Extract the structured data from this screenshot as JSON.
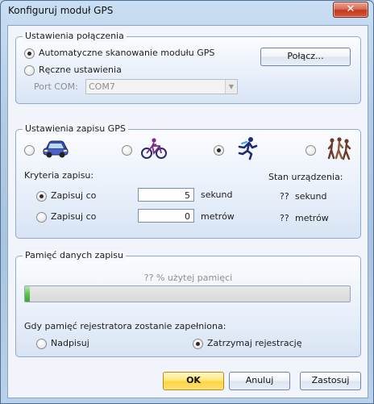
{
  "window": {
    "title": "Konfiguruj moduł GPS",
    "close_glyph": "✕"
  },
  "connection": {
    "title": "Ustawienia połączenia",
    "auto_scan_label": "Automatyczne skanowanie modułu GPS",
    "manual_label": "Ręczne ustawienia",
    "selected_mode": "auto",
    "port_label": "Port COM:",
    "port_value": "COM7",
    "connect_button": "Połącz..."
  },
  "logging": {
    "title": "Ustawienia zapisu GPS",
    "profiles": [
      {
        "name": "car",
        "icon": "car-icon",
        "selected": false
      },
      {
        "name": "bicycle",
        "icon": "bicycle-icon",
        "selected": false
      },
      {
        "name": "running",
        "icon": "runner-icon",
        "selected": true
      },
      {
        "name": "hiking",
        "icon": "hikers-icon",
        "selected": false
      }
    ],
    "criteria_label": "Kryteria zapisu:",
    "options": [
      {
        "label": "Zapisuj co",
        "value": "5",
        "unit": "sekund",
        "selected": true
      },
      {
        "label": "Zapisuj co",
        "value": "0",
        "unit": "metrów",
        "selected": false
      }
    ],
    "device_status_label": "Stan urządzenia:",
    "device_status": [
      {
        "value": "??",
        "unit": "sekund"
      },
      {
        "value": "??",
        "unit": "metrów"
      }
    ]
  },
  "memory": {
    "title": "Pamięć danych zapisu",
    "usage_text": "?? % użytej pamięci",
    "usage_fraction": 0.015,
    "full_label": "Gdy pamięć rejestratora zostanie zapełniona:",
    "overwrite_label": "Nadpisuj",
    "stop_label": "Zatrzymaj rejestrację",
    "selected_action": "stop"
  },
  "buttons": {
    "ok": "OK",
    "cancel": "Anuluj",
    "apply": "Zastosuj"
  },
  "colors": {
    "accent": "#ffd43c",
    "progress_green": "#3aa92a",
    "group_border": "#8fa9cf"
  }
}
